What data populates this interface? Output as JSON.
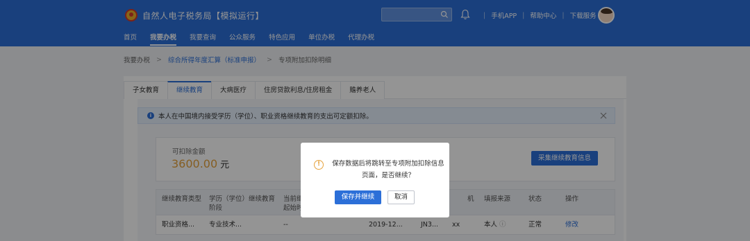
{
  "header": {
    "title": "自然人电子税务局【模拟运行】",
    "search_placeholder": "",
    "links": [
      "手机APP",
      "帮助中心",
      "下载服务"
    ],
    "nav": [
      "首页",
      "我要办税",
      "我要查询",
      "公众服务",
      "特色应用",
      "单位办税",
      "代理办税"
    ]
  },
  "breadcrumb": {
    "root": "我要办税",
    "mid": "综合所得年度汇算（标准申报）",
    "current": "专项附加扣除明细"
  },
  "tabs": [
    "子女教育",
    "继续教育",
    "大病医疗",
    "住房贷款利息/住房租金",
    "赡养老人"
  ],
  "notice": {
    "text": "本人在中国境内接受学历（学位）、职业资格继续教育的支出可定额扣除。"
  },
  "amount": {
    "label": "可扣除金额",
    "value": "3600.00",
    "unit": "元",
    "collect_button": "采集继续教育信息"
  },
  "table": {
    "headers": [
      "继续教育类型",
      "学历（学位）继续教育阶段",
      "当前继续教育起始时间",
      "",
      "机",
      "填报来源",
      "状态",
      "操作"
    ],
    "row": {
      "type": "职业资格...",
      "stage": "专业技术...",
      "start": "--",
      "date": "2019-12...",
      "code": "JN3...",
      "extra": "xx",
      "source": "本人",
      "status": "正常",
      "action": "修改"
    }
  },
  "dialog": {
    "message": "保存数据后将跳转至专项附加扣除信息页面，是否继续？",
    "ok": "保存并继续",
    "cancel": "取消"
  },
  "colors": {
    "primary": "#2c6fd8",
    "warning": "#e6a23c"
  }
}
